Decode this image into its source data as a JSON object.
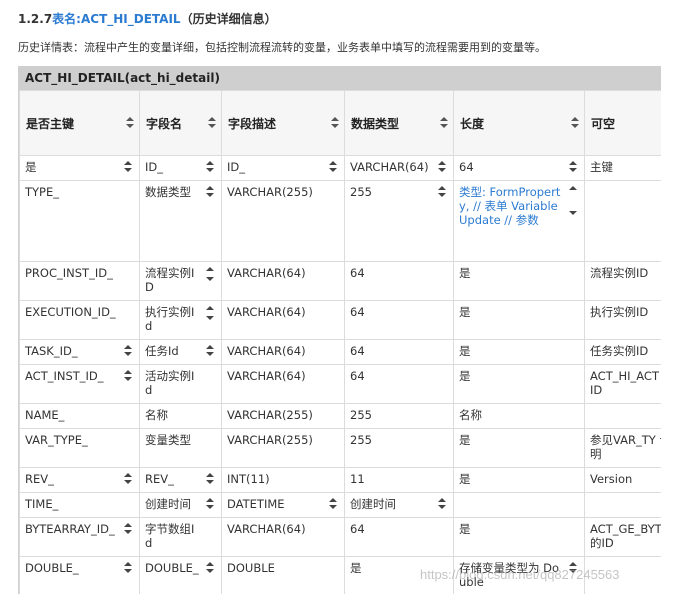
{
  "heading": {
    "number": "1.2.7",
    "label": "表名:",
    "table_name": "ACT_HI_DETAIL",
    "suffix": "（历史详细信息）"
  },
  "description": "历史详情表：流程中产生的变量详细，包括控制流程流转的变量，业务表单中填写的流程需要用到的变量等。",
  "table": {
    "caption": "ACT_HI_DETAIL(act_hi_detail)",
    "columns": [
      "是否主键",
      "字段名",
      "字段描述",
      "数据类型",
      "长度",
      "可空"
    ],
    "rows": [
      [
        "是",
        "ID_",
        "ID_",
        "VARCHAR(64)",
        "64",
        "主键"
      ],
      [
        "TYPE_",
        "数据类型",
        "VARCHAR(255)",
        "255",
        "类型: FormProperty, // 表单 VariableUpdate // 参数",
        ""
      ],
      [
        "PROC_INST_ID_",
        "流程实例ID",
        "VARCHAR(64)",
        "64",
        "是",
        "流程实例ID"
      ],
      [
        "EXECUTION_ID_",
        "执行实例Id",
        "VARCHAR(64)",
        "64",
        "是",
        "执行实例ID"
      ],
      [
        "TASK_ID_",
        "任务Id",
        "VARCHAR(64)",
        "64",
        "是",
        "任务实例ID"
      ],
      [
        "ACT_INST_ID_",
        "活动实例Id",
        "VARCHAR(64)",
        "64",
        "是",
        "ACT_HI_ACT 的ID"
      ],
      [
        "NAME_",
        "名称",
        "VARCHAR(255)",
        "255",
        "名称",
        ""
      ],
      [
        "VAR_TYPE_",
        "变量类型",
        "VARCHAR(255)",
        "255",
        "是",
        "参见VAR_TY 说明"
      ],
      [
        "REV_",
        "REV_",
        "INT(11)",
        "11",
        "是",
        "Version"
      ],
      [
        "TIME_",
        "创建时间",
        "DATETIME",
        "创建时间",
        "",
        ""
      ],
      [
        "BYTEARRAY_ID_",
        "字节数组Id",
        "VARCHAR(64)",
        "64",
        "是",
        "ACT_GE_BYT 表的ID"
      ],
      [
        "DOUBLE_",
        "DOUBLE_",
        "DOUBLE",
        "是",
        "存储变量类型为 Double",
        ""
      ]
    ]
  },
  "watermark": "https://blog.csdn.net/qq827245563"
}
